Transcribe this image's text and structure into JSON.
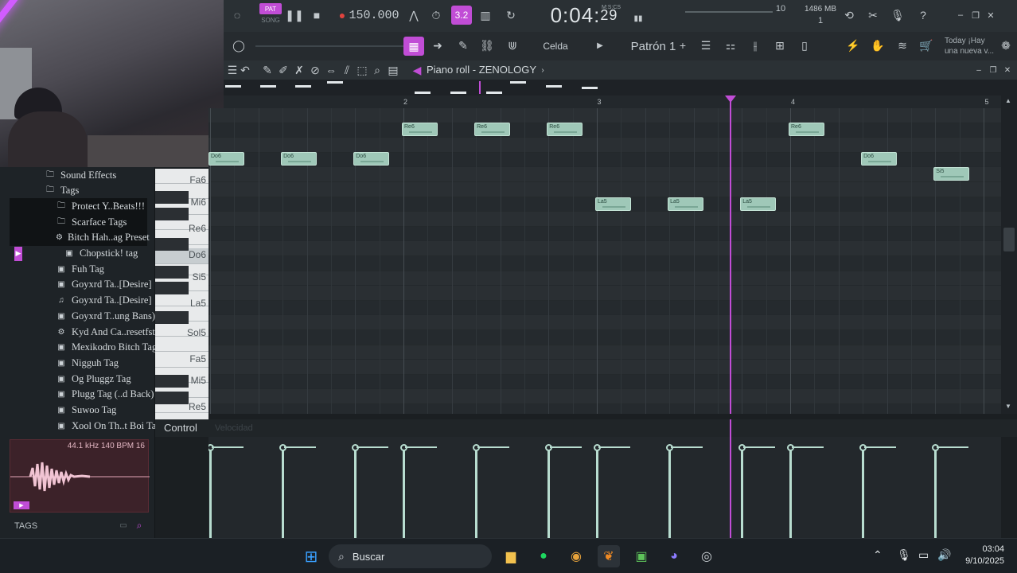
{
  "transport": {
    "pat_label": "PAT",
    "song_label": "SONG",
    "tempo": "150.000",
    "time_main": "0:04",
    "time_sub": "29",
    "time_unit": "M:S:CS",
    "step": "3.2",
    "cpu": "10",
    "memory": "1486 MB",
    "voices": "1"
  },
  "toolbar": {
    "snap": "Celda",
    "pattern": "Patrón 1",
    "add": "+",
    "news_line1": "Today ¡Hay",
    "news_line2": "una nueva v..."
  },
  "browser": {
    "items": [
      {
        "label": "Sound Effects",
        "icon": "folder-icon",
        "indent": 1
      },
      {
        "label": "Tags",
        "icon": "folder-icon",
        "indent": 1
      },
      {
        "label": "Protect Y..Beats!!!",
        "icon": "folder-icon",
        "indent": 2
      },
      {
        "label": "Scarface Tags",
        "icon": "folder-icon",
        "indent": 2
      },
      {
        "label": "Bitch Hah..ag Preset",
        "icon": "gear-icon",
        "indent": 2
      },
      {
        "label": "Chopstick! tag",
        "icon": "audio-file-icon",
        "indent": 3
      },
      {
        "label": "Fuh Tag",
        "icon": "audio-file-icon",
        "indent": 2
      },
      {
        "label": "Goyxrd Ta..[Desire]",
        "icon": "audio-file-icon",
        "indent": 2
      },
      {
        "label": "Goyxrd Ta..[Desire]",
        "icon": "mp3-file-icon",
        "indent": 2
      },
      {
        "label": "Goyxrd T..ung Bans)",
        "icon": "audio-file-icon",
        "indent": 2
      },
      {
        "label": "Kyd And Ca..resetfst",
        "icon": "gear-icon",
        "indent": 2
      },
      {
        "label": "Mexikodro Bitch Tag",
        "icon": "audio-file-icon",
        "indent": 2
      },
      {
        "label": "Nigguh Tag",
        "icon": "audio-file-icon",
        "indent": 2
      },
      {
        "label": "Og Pluggz Tag",
        "icon": "audio-file-icon",
        "indent": 2
      },
      {
        "label": "Plugg Tag (..d Back)",
        "icon": "audio-file-icon",
        "indent": 2
      },
      {
        "label": "Suwoo Tag",
        "icon": "audio-file-icon",
        "indent": 2
      },
      {
        "label": "Xool On Th..t Boi Tag",
        "icon": "audio-file-icon",
        "indent": 2
      }
    ],
    "wave_info": "44.1 kHz 140 BPM 16",
    "tags_label": "TAGS"
  },
  "piano_roll": {
    "title": "Piano roll - ZENOLOGY",
    "bars": [
      "2",
      "3",
      "4",
      "5"
    ],
    "key_labels": [
      "Fa6",
      "Mi6",
      "Re6",
      "Do6",
      "Si5",
      "La5",
      "Sol5",
      "Fa5",
      "Mi5",
      "Re5"
    ],
    "notes": [
      {
        "pitch": "Do6",
        "label": "Do6",
        "start": 0,
        "len": 0.375
      },
      {
        "pitch": "Do6",
        "label": "Do6",
        "start": 0.75,
        "len": 0.375
      },
      {
        "pitch": "Do6",
        "label": "Do6",
        "start": 1.5,
        "len": 0.375
      },
      {
        "pitch": "Re6",
        "label": "Re6",
        "start": 2.0,
        "len": 0.375
      },
      {
        "pitch": "Re6",
        "label": "Re6",
        "start": 2.75,
        "len": 0.375
      },
      {
        "pitch": "Re6",
        "label": "Re6",
        "start": 3.5,
        "len": 0.375
      },
      {
        "pitch": "La5",
        "label": "La5",
        "start": 4.0,
        "len": 0.375
      },
      {
        "pitch": "La5",
        "label": "La5",
        "start": 4.75,
        "len": 0.375
      },
      {
        "pitch": "La5",
        "label": "La5",
        "start": 5.5,
        "len": 0.375
      },
      {
        "pitch": "Re6",
        "label": "Re6",
        "start": 6.0,
        "len": 0.375
      },
      {
        "pitch": "Do6",
        "label": "Do6",
        "start": 6.75,
        "len": 0.375
      },
      {
        "pitch": "Si5",
        "label": "Si5",
        "start": 7.5,
        "len": 0.375
      }
    ],
    "playhead_beat": 5.5,
    "control_label": "Control",
    "control_sub": "Velocidad"
  },
  "taskbar": {
    "search_label": "Buscar",
    "time": "03:04",
    "date": "9/10/2025"
  },
  "colors": {
    "accent": "#c14dd6",
    "note_fill": "#9fc8b8",
    "grid_bg": "#2a2f33"
  }
}
